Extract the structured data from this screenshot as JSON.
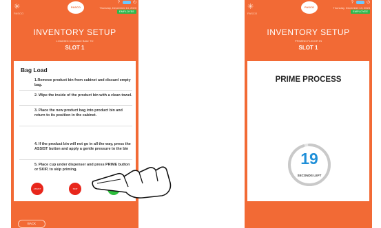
{
  "header": {
    "corner_label": "PASCO",
    "brand_text": "PASCO",
    "status_icons": "? ⌂",
    "date": "Thursday, December 14, 2023",
    "employee_badge": "EMPLOYEE"
  },
  "left_screen": {
    "title": "INVENTORY SETUP",
    "subtitle": "LOADING Chocolate Base TO",
    "slot": "SLOT 1",
    "section_title": "Bag Load",
    "steps": [
      "1.Remove product bin from cabinet and discard empty bag.",
      "2. Wipe the inside of the product bin with a clean towel.",
      "3. Place the new product bag into product bin and return to its position in the cabinet.",
      "4. If the product bin will not go in all the way, press the ASSIST button and apply a gentle pressure to the bin",
      "5. Place cup under dispenser and press PRIME button or SKIP, to skip priming."
    ],
    "buttons": {
      "assist_label": "ASSIST",
      "skip_label": "SKIP",
      "prime_label": "PRIME"
    },
    "back_label": "BACK"
  },
  "right_screen": {
    "title": "INVENTORY SETUP",
    "subtitle": "PRIMING FLAVOR IN",
    "slot": "SLOT 1",
    "process_title": "PRIME PROCESS",
    "counter_value": "19",
    "counter_label": "SECONDS LEFT",
    "progress_fraction": 0.95
  },
  "colors": {
    "brand_orange": "#f26a35",
    "assist_red": "#e8261b",
    "prime_green": "#2dbf3d",
    "counter_blue": "#1f8fd8"
  }
}
